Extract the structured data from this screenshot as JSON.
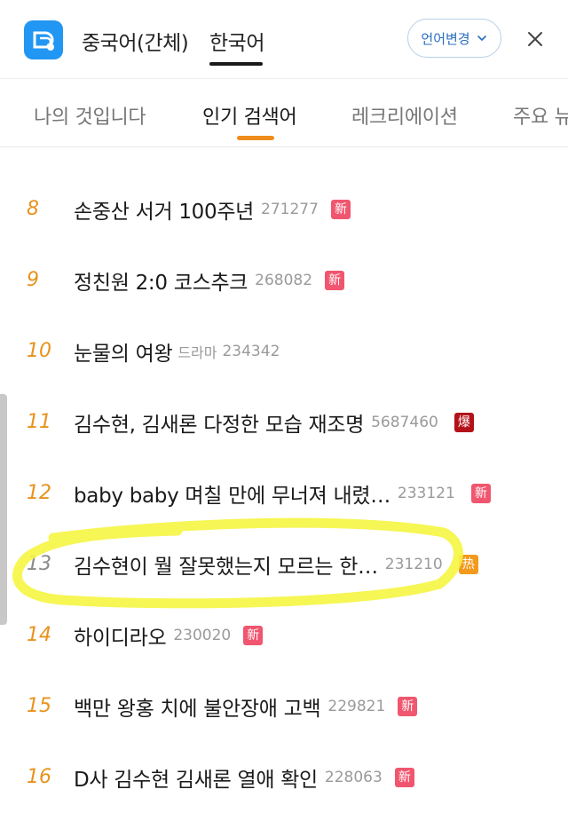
{
  "header": {
    "lang_tabs": [
      {
        "label": "중국어(간체)"
      },
      {
        "label": "한국어"
      }
    ],
    "change_lang_label": "언어변경"
  },
  "category_tabs": [
    {
      "label": "나의 것입니다"
    },
    {
      "label": "인기 검색어"
    },
    {
      "label": "레크리에이션"
    },
    {
      "label": "주요 뉴"
    }
  ],
  "colors": {
    "accent_orange": "#f08c1c",
    "badge_new": "#f0566f",
    "badge_boom": "#b3121a",
    "badge_hot": "#f29a1e",
    "highlight": "#f5f542"
  },
  "list": [
    {
      "rank": "8",
      "title": "손중산 서거 100주년",
      "sub": "",
      "count": "271277",
      "badge": "新"
    },
    {
      "rank": "9",
      "title": "정친원 2:0 코스추크",
      "sub": "",
      "count": "268082",
      "badge": "新"
    },
    {
      "rank": "10",
      "title": "눈물의 여왕",
      "sub": "드라마",
      "count": "234342",
      "badge": ""
    },
    {
      "rank": "11",
      "title": "김수현, 김새론 다정한 모습 재조명",
      "sub": "",
      "count": "5687460",
      "badge": "爆"
    },
    {
      "rank": "12",
      "title": "baby baby 며칠 만에 무너져 내렸…",
      "sub": "",
      "count": "233121",
      "badge": "新"
    },
    {
      "rank": "13",
      "title": "김수현이 뭘 잘못했는지 모르는 한…",
      "sub": "",
      "count": "231210",
      "badge": "热"
    },
    {
      "rank": "14",
      "title": "하이디라오",
      "sub": "",
      "count": "230020",
      "badge": "新"
    },
    {
      "rank": "15",
      "title": "백만 왕홍 치에 불안장애 고백",
      "sub": "",
      "count": "229821",
      "badge": "新"
    },
    {
      "rank": "16",
      "title": "D사 김수현 김새론 열애 확인",
      "sub": "",
      "count": "228063",
      "badge": "新"
    }
  ]
}
